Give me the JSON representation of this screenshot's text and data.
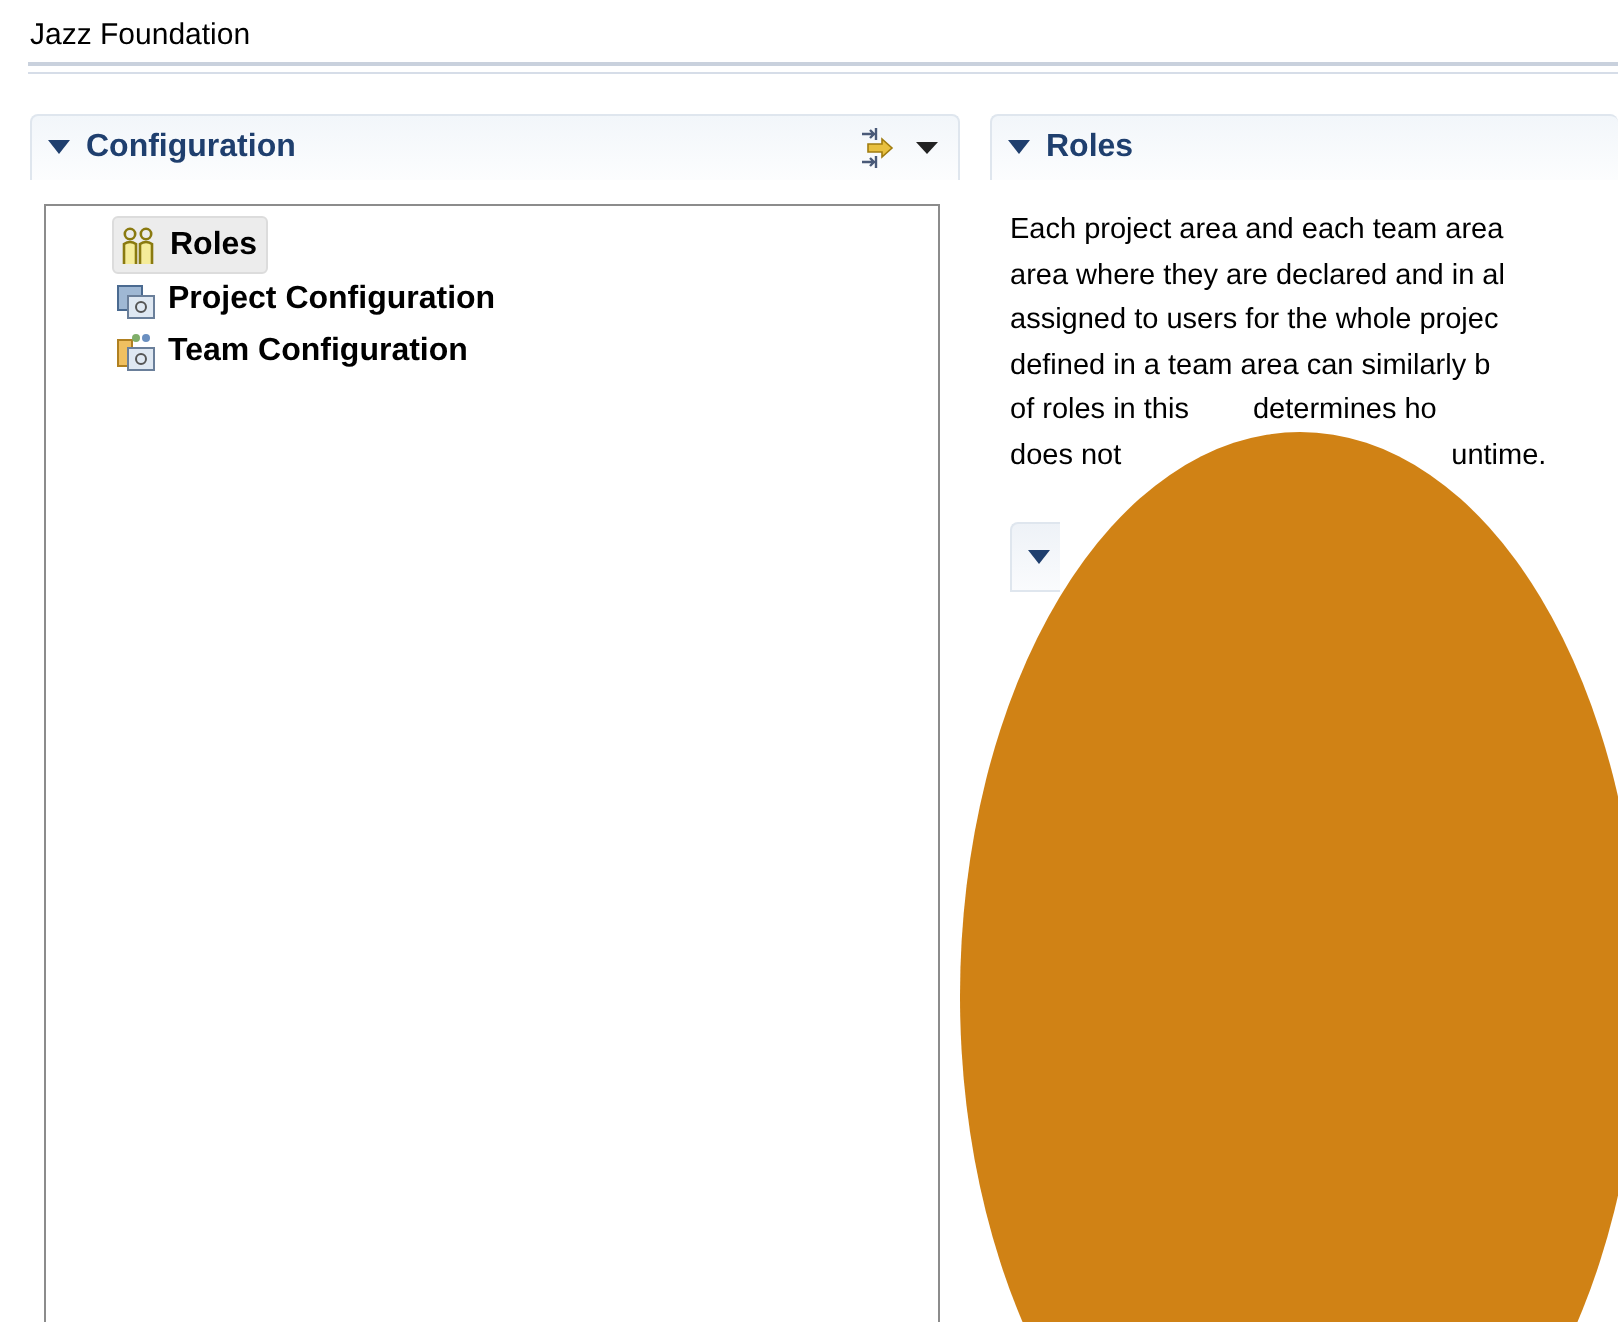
{
  "window": {
    "title": "Jazz Foundation"
  },
  "configuration": {
    "title": "Configuration",
    "expanded": true,
    "items": [
      {
        "label": "Roles",
        "kind": "roles",
        "selected": true
      },
      {
        "label": "Project Configuration",
        "kind": "project",
        "selected": false
      },
      {
        "label": "Team Configuration",
        "kind": "team",
        "selected": false
      }
    ]
  },
  "roles_section": {
    "title": "Roles",
    "expanded": true,
    "description_lines": [
      [
        "Each project area and each team area"
      ],
      [
        "area where they are declared and in al"
      ],
      [
        "assigned to users for the whole projec"
      ],
      [
        "defined in a team area can similarly b"
      ],
      [
        "of roles in this",
        "determines ho"
      ],
      [
        "does not",
        "untime."
      ]
    ],
    "subsection": {
      "expanded": true
    }
  }
}
